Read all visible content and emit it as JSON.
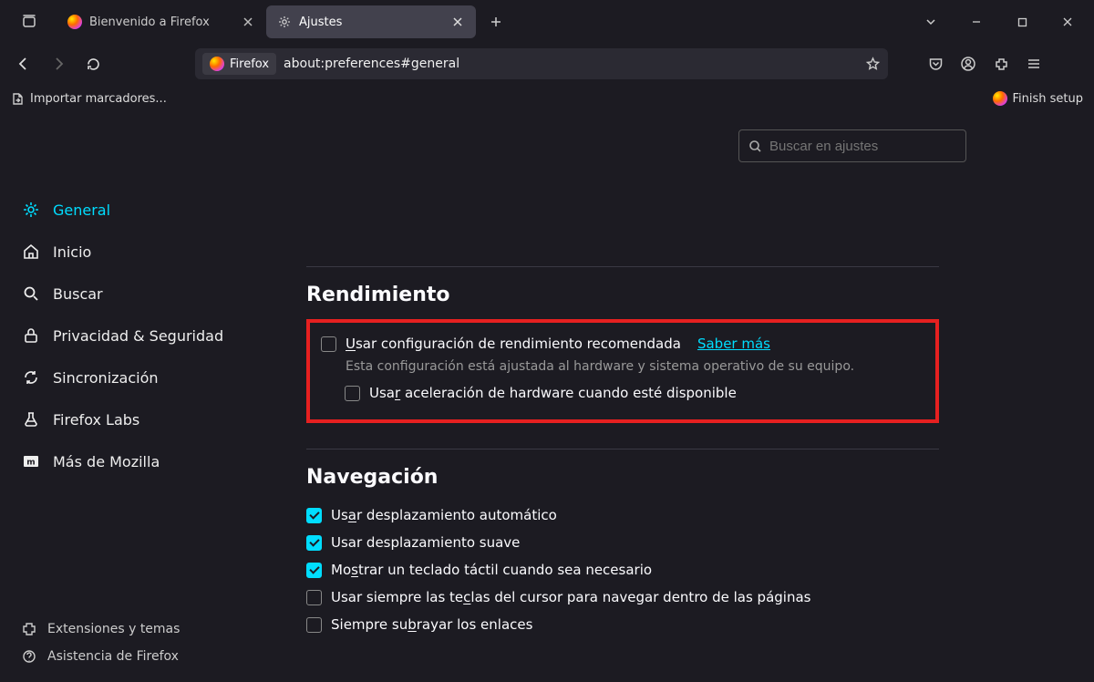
{
  "tabs": [
    {
      "title": "Bienvenido a Firefox",
      "active": false
    },
    {
      "title": "Ajustes",
      "active": true
    }
  ],
  "url": "about:preferences#general",
  "identity_label": "Firefox",
  "bookmarks": {
    "import": "Importar marcadores...",
    "finish_setup": "Finish setup"
  },
  "search_placeholder": "Buscar en ajustes",
  "sidebar": {
    "items": [
      {
        "label": "General"
      },
      {
        "label": "Inicio"
      },
      {
        "label": "Buscar"
      },
      {
        "label": "Privacidad & Seguridad"
      },
      {
        "label": "Sincronización"
      },
      {
        "label": "Firefox Labs"
      },
      {
        "label": "Más de Mozilla"
      }
    ],
    "footer": [
      {
        "label": "Extensiones y temas"
      },
      {
        "label": "Asistencia de Firefox"
      }
    ]
  },
  "sections": {
    "performance": {
      "title": "Rendimiento",
      "recommended_label": "Usar configuración de rendimiento recomendada",
      "recommended_u": "U",
      "learn_more": "Saber más",
      "desc": "Esta configuración está ajustada al hardware y sistema operativo de su equipo.",
      "hw_accel_label": "Usar aceleración de hardware cuando esté disponible",
      "hw_accel_u": "r"
    },
    "browsing": {
      "title": "Navegación",
      "items": [
        {
          "checked": true,
          "label": "Usar desplazamiento automático",
          "u": "a"
        },
        {
          "checked": true,
          "label": "Usar desplazamiento suave",
          "u": ""
        },
        {
          "checked": true,
          "label": "Mostrar un teclado táctil cuando sea necesario",
          "u": "s"
        },
        {
          "checked": false,
          "label": "Usar siempre las teclas del cursor para navegar dentro de las páginas",
          "u": "c"
        },
        {
          "checked": false,
          "label": "Siempre subrayar los enlaces",
          "u": "b"
        }
      ]
    }
  }
}
